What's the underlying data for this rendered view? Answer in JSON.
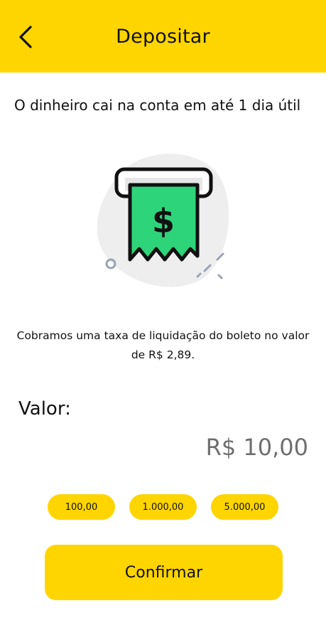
{
  "header": {
    "title": "Depositar",
    "back_icon": "chevron-left-icon"
  },
  "info": {
    "text": "O dinheiro cai na conta em até 1 dia útil"
  },
  "illustration": {
    "icon": "bill-dispenser-dollar-icon",
    "symbol": "$"
  },
  "fee": {
    "text": "Cobramos uma taxa de liquidação do boleto no valor de R$ 2,89."
  },
  "amount": {
    "label": "Valor:",
    "value": "R$ 10,00"
  },
  "quick_amounts": [
    "100,00",
    "1.000,00",
    "5.000,00"
  ],
  "actions": {
    "confirm_label": "Confirmar"
  },
  "colors": {
    "accent": "#FFD500",
    "bill_green": "#2ED47A",
    "muted_value": "#6F6F6F"
  }
}
